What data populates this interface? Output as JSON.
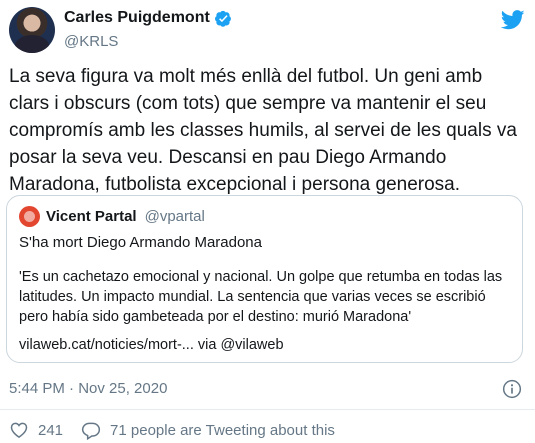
{
  "author": {
    "name": "Carles Puigdemont",
    "handle": "@KRLS",
    "verified": true
  },
  "tweet_text": "La seva figura va molt més enllà del futbol. Un geni amb clars i obscurs (com tots) que sempre va mantenir el seu compromís amb les classes humils, al servei de les quals va posar la seva veu. Descansi en pau Diego Armando Maradona, futbolista excepcional i persona generosa.",
  "quoted_tweet": {
    "name": "Vicent Partal",
    "handle": "@vpartal",
    "headline": "S'ha mort Diego Armando Maradona",
    "body": "'Es un cachetazo emocional y nacional. Un golpe que retumba en todas las latitudes. Un impacto mundial. La sentencia que varias veces se escribió pero había sido gambeteada por el destino: murió Maradona'",
    "link": "vilaweb.cat/noticies/mort-... via @vilaweb"
  },
  "timestamp": "5:44 PM · Nov 25, 2020",
  "likes_count": "241",
  "tweeting_text": "71 people are Tweeting about this",
  "icons": {
    "brand": "twitter-bird-icon",
    "verified": "verified-badge-icon",
    "info": "info-icon",
    "like": "heart-icon",
    "reply": "comment-icon"
  },
  "colors": {
    "brand_blue": "#1da1f2",
    "secondary_text": "#657786",
    "primary_text": "#14171a",
    "border": "#ccd6dd"
  }
}
